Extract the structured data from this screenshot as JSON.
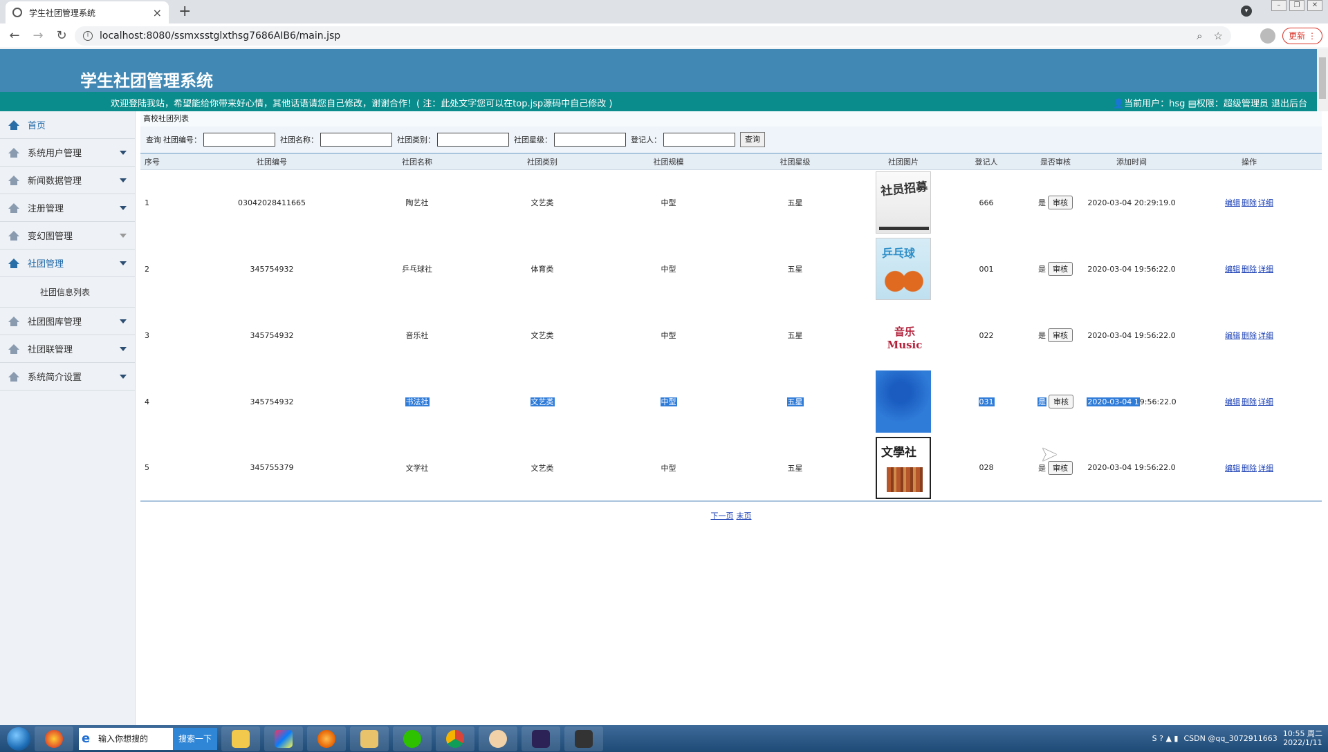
{
  "browser": {
    "tab_title": "学生社团管理系统",
    "tab_close": "×",
    "new_tab": "+",
    "url": "localhost:8080/ssmxsstglxthsg7686AIB6/main.jsp",
    "update_label": "更新"
  },
  "header": {
    "title": "学生社团管理系统",
    "welcome": "欢迎登陆我站，希望能给你带来好心情，其他话语请您自己修改，谢谢合作！( 注：此处文字您可以在top.jsp源码中自己修改 )",
    "current_user": "当前用户：hsg",
    "role": "权限：超级管理员",
    "logout": "退出后台"
  },
  "sidebar": {
    "items": [
      {
        "label": "首页"
      },
      {
        "label": "系统用户管理"
      },
      {
        "label": "新闻数据管理"
      },
      {
        "label": "注册管理"
      },
      {
        "label": "变幻图管理"
      },
      {
        "label": "社团管理"
      },
      {
        "label": "社团图库管理"
      },
      {
        "label": "社团联管理"
      },
      {
        "label": "系统简介设置"
      }
    ],
    "submenu_label": "社团信息列表"
  },
  "main": {
    "breadcrumb": "高校社团列表",
    "search": {
      "query_label": "查询",
      "field1": "社团编号：",
      "field2": "社团名称：",
      "field3": "社团类别：",
      "field4": "社团星级：",
      "field5": "登记人：",
      "button": "查询"
    },
    "columns": [
      "序号",
      "社团编号",
      "社团名称",
      "社团类别",
      "社团规模",
      "社团星级",
      "社团图片",
      "登记人",
      "是否审核",
      "添加时间",
      "操作"
    ],
    "rows": [
      {
        "no": "1",
        "code": "03042028411665",
        "name": "陶艺社",
        "category": "文艺类",
        "scale": "中型",
        "stars": "五星",
        "image_text": "社员招募",
        "registrar": "666",
        "audited": "是",
        "audit_btn": "审核",
        "time": "2020-03-04 20:29:19.0"
      },
      {
        "no": "2",
        "code": "345754932",
        "name": "乒乓球社",
        "category": "体育类",
        "scale": "中型",
        "stars": "五星",
        "image_text": "乒乓球",
        "registrar": "001",
        "audited": "是",
        "audit_btn": "审核",
        "time": "2020-03-04 19:56:22.0"
      },
      {
        "no": "3",
        "code": "345754932",
        "name": "音乐社",
        "category": "文艺类",
        "scale": "中型",
        "stars": "五星",
        "image_text": "音乐Music",
        "registrar": "022",
        "audited": "是",
        "audit_btn": "审核",
        "time": "2020-03-04 19:56:22.0"
      },
      {
        "no": "4",
        "code": "345754932",
        "name": "书法社",
        "category": "文艺类",
        "scale": "中型",
        "stars": "五星",
        "image_text": "",
        "registrar": "031",
        "audited": "是",
        "audit_btn": "审核",
        "time_selected": "2020-03-04 1",
        "time_rest": "9:56:22.0"
      },
      {
        "no": "5",
        "code": "345755379",
        "name": "文学社",
        "category": "文艺类",
        "scale": "中型",
        "stars": "五星",
        "image_text": "文學社",
        "registrar": "028",
        "audited": "是",
        "audit_btn": "审核",
        "time": "2020-03-04 19:56:22.0"
      }
    ],
    "ops": {
      "edit": "编辑",
      "delete": "删除",
      "detail": "详细"
    },
    "pager": {
      "next": "下一页",
      "last": "末页"
    }
  },
  "taskbar": {
    "search_placeholder": "输入你想搜的",
    "search_button": "搜索一下",
    "watermark": "CSDN @qq_3072911663",
    "time": "10:55 周二",
    "date": "2022/1/11"
  },
  "colors": {
    "header_bg": "#4189b4",
    "welcome_bg": "#0a8c8c",
    "selection": "#2f7bd8"
  }
}
